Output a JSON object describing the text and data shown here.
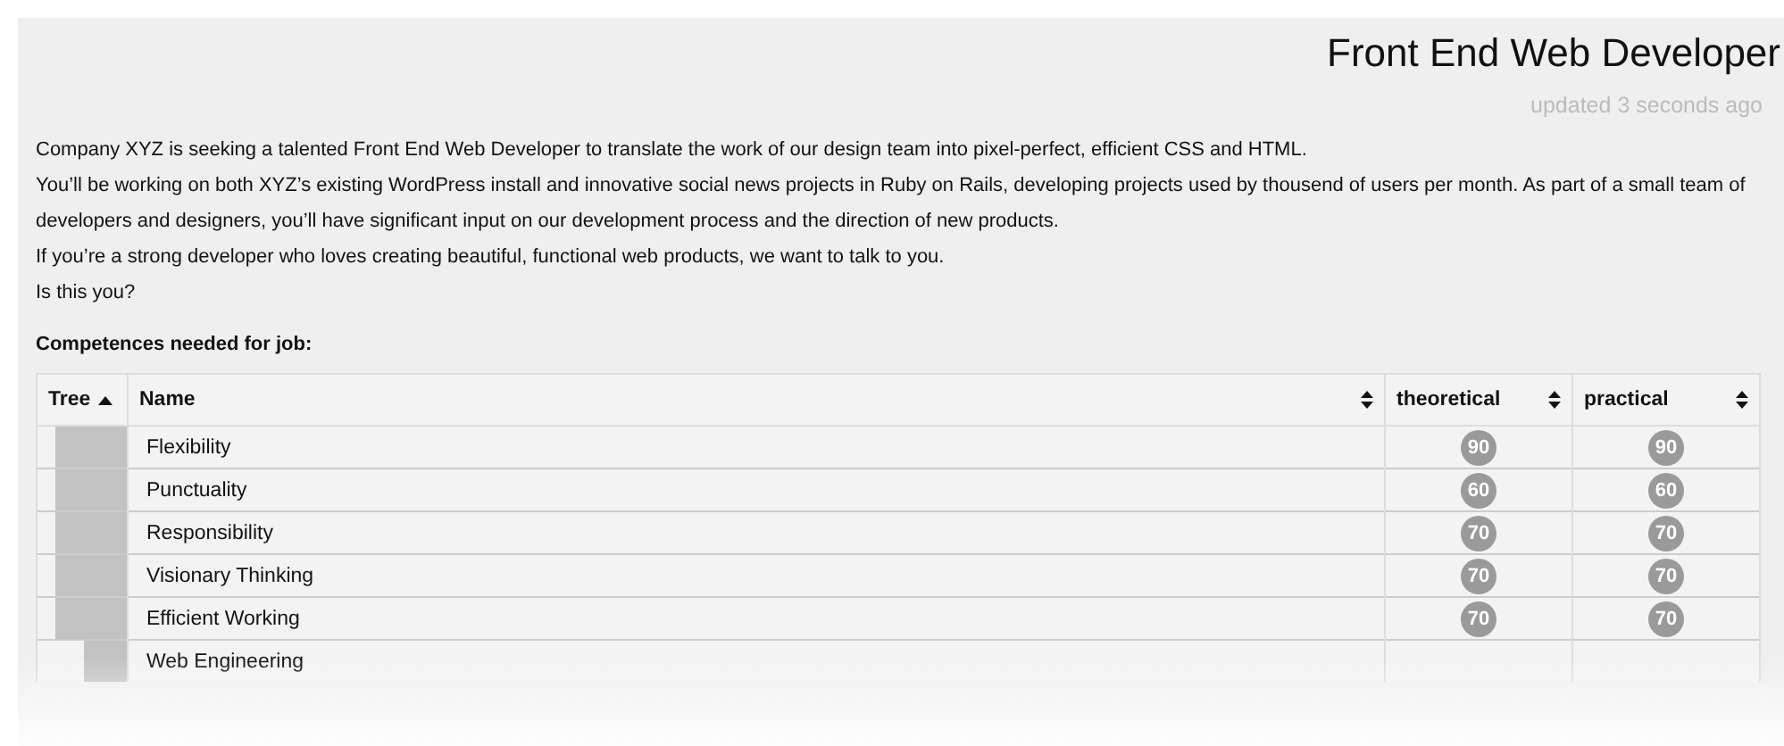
{
  "title": "Front End Web Developer",
  "updated": "updated 3 seconds ago",
  "description": [
    "Company XYZ is seeking a talented Front End Web Developer to translate the work of our design team into pixel-perfect, efficient CSS and HTML.",
    "You’ll be working on both XYZ’s existing WordPress install and innovative social news projects in Ruby on Rails, developing projects used by thousend of users per month. As part of a small team of developers and designers, you’ll have significant input on our development process and the direction of new products.",
    "If you’re a strong developer who loves creating beautiful, functional web products, we want to talk to you.",
    "Is this you?"
  ],
  "competences_heading": "Competences needed for job:",
  "table": {
    "columns": [
      {
        "label": "Tree",
        "sorted": true
      },
      {
        "label": "Name",
        "sorted": false
      },
      {
        "label": "theoretical",
        "sorted": false
      },
      {
        "label": "practical",
        "sorted": false
      }
    ],
    "rows": [
      {
        "name": "Flexibility",
        "theoretical": "90",
        "practical": "90"
      },
      {
        "name": "Punctuality",
        "theoretical": "60",
        "practical": "60"
      },
      {
        "name": "Responsibility",
        "theoretical": "70",
        "practical": "70"
      },
      {
        "name": "Visionary Thinking",
        "theoretical": "70",
        "practical": "70"
      },
      {
        "name": "Efficient Working",
        "theoretical": "70",
        "practical": "70",
        "children": [
          {
            "name": "Web Engineering"
          }
        ]
      }
    ]
  }
}
